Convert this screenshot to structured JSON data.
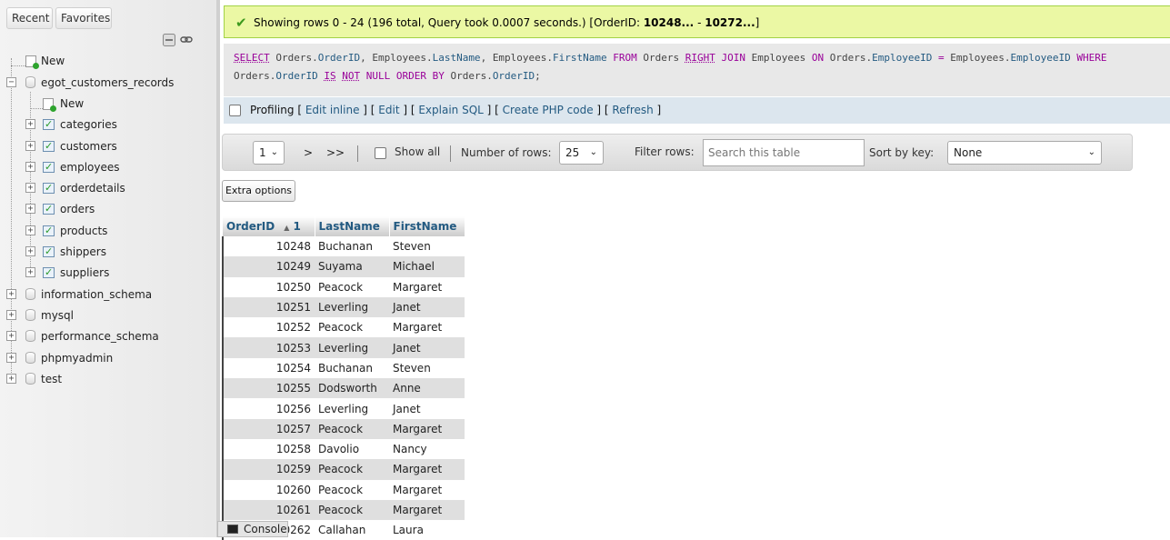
{
  "nav": {
    "tabs": {
      "recent": "Recent",
      "favorites": "Favorites"
    },
    "new_root": "New",
    "current_db": {
      "name": "egot_customers_records",
      "new": "New",
      "tables": [
        "categories",
        "customers",
        "employees",
        "orderdetails",
        "orders",
        "products",
        "shippers",
        "suppliers"
      ]
    },
    "databases": [
      "information_schema",
      "mysql",
      "performance_schema",
      "phpmyadmin",
      "test"
    ]
  },
  "success": {
    "text": "Showing rows 0 - 24 (196 total, Query took 0.0007 seconds.) [OrderID: ",
    "range_start": "10248...",
    "range_mid": " - ",
    "range_end": "10272...",
    "range_close": "]"
  },
  "sql": {
    "select": "SELECT",
    "t_orders": "Orders.",
    "c_orderid": "OrderID",
    "comma1": ", ",
    "t_employees": "Employees.",
    "c_lastname": "LastName",
    "comma2": ", ",
    "t_employees2": "Employees.",
    "c_firstname": "FirstName",
    "from": "FROM",
    "orders_tbl": "Orders",
    "right": "RIGHT",
    "join": "JOIN",
    "employees_tbl": "Employees",
    "on": "ON",
    "t_orders2": "Orders.",
    "c_empid1": "EmployeeID",
    "eq": "=",
    "t_employees3": "Employees.",
    "c_empid2": "EmployeeID",
    "where": "WHERE",
    "t_orders3": "Orders.",
    "c_orderid2": "OrderID",
    "is": "IS",
    "not": "NOT",
    "null": "NULL",
    "orderby": "ORDER BY",
    "t_orders4": "Orders.",
    "c_orderid3": "OrderID",
    "semi": ";"
  },
  "sql_tools": {
    "profiling": "Profiling",
    "edit_inline": "Edit inline",
    "edit": "Edit",
    "explain": "Explain SQL",
    "php": "Create PHP code",
    "refresh": "Refresh"
  },
  "navbar": {
    "page": "1",
    "next": ">",
    "last": ">>",
    "show_all": "Show all",
    "rows_label": "Number of rows:",
    "rows_value": "25",
    "filter_label": "Filter rows:",
    "filter_placeholder": "Search this table",
    "sort_label": "Sort by key:",
    "sort_value": "None"
  },
  "extra_options": "Extra options",
  "table": {
    "headers": [
      "OrderID",
      "LastName",
      "FirstName"
    ],
    "sort_indicator": "▲",
    "sort_index": "1",
    "rows": [
      [
        "10248",
        "Buchanan",
        "Steven"
      ],
      [
        "10249",
        "Suyama",
        "Michael"
      ],
      [
        "10250",
        "Peacock",
        "Margaret"
      ],
      [
        "10251",
        "Leverling",
        "Janet"
      ],
      [
        "10252",
        "Peacock",
        "Margaret"
      ],
      [
        "10253",
        "Leverling",
        "Janet"
      ],
      [
        "10254",
        "Buchanan",
        "Steven"
      ],
      [
        "10255",
        "Dodsworth",
        "Anne"
      ],
      [
        "10256",
        "Leverling",
        "Janet"
      ],
      [
        "10257",
        "Peacock",
        "Margaret"
      ],
      [
        "10258",
        "Davolio",
        "Nancy"
      ],
      [
        "10259",
        "Peacock",
        "Margaret"
      ],
      [
        "10260",
        "Peacock",
        "Margaret"
      ],
      [
        "10261",
        "Peacock",
        "Margaret"
      ],
      [
        "10262",
        "Callahan",
        "Laura"
      ]
    ]
  },
  "console": "Console"
}
